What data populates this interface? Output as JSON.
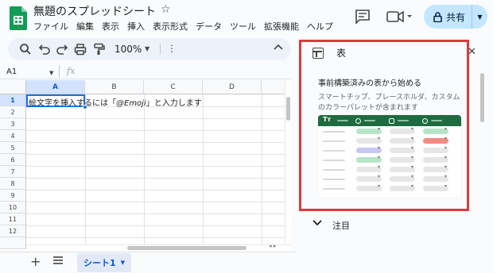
{
  "title_bar": {
    "doc_title": "無題のスプレッドシート",
    "star_glyph": "☆",
    "share_label": "共有"
  },
  "menu": [
    "ファイル",
    "編集",
    "表示",
    "挿入",
    "表示形式",
    "データ",
    "ツール",
    "拡張機能",
    "ヘルプ"
  ],
  "toolbar": {
    "zoom": "100%"
  },
  "formula_bar": {
    "name_box": "A1",
    "fx": "fx",
    "formula": ""
  },
  "grid": {
    "columns": [
      "A",
      "B",
      "C",
      "D"
    ],
    "selected_column": "A",
    "rows": [
      "1",
      "2",
      "3",
      "4",
      "5",
      "6",
      "7",
      "8",
      "9",
      "10",
      "11",
      "12"
    ],
    "selected_row": "1",
    "a1_text_before": "絵文字を挿入するには「",
    "a1_text_italic": "@Emoji",
    "a1_text_after": "」と入力します"
  },
  "sheets": {
    "active_tab": "シート1"
  },
  "side_panel": {
    "title": "表",
    "heading": "事前構築済みの表から始める",
    "description": "スマートチップ、プレースホルダ、カスタムのカラーパレットが含まれます",
    "preview_header_glyph": "Tт",
    "notes_label": "注目",
    "chip_colors": {
      "green": "#b7e4c7",
      "purple": "#c9c7f2",
      "salmon": "#f28b82",
      "gray": "#e6e6e6"
    }
  },
  "colors": {
    "accent": "#1a73e8",
    "share_bg": "#c2e7ff",
    "highlight_box": "#e0393e",
    "sheets_green": "#0f9d58"
  }
}
